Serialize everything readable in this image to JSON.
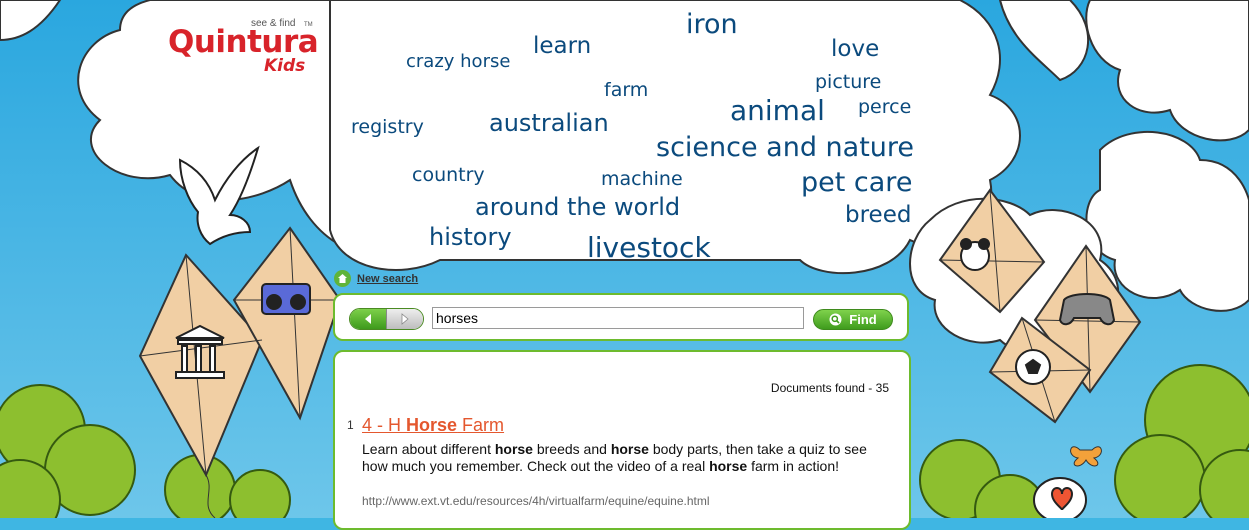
{
  "logo": {
    "brand": "Quintura",
    "tagline": "see & find",
    "trademark": "TM",
    "sub": "Kids"
  },
  "tag_cloud": [
    {
      "id": "iron",
      "text": "iron"
    },
    {
      "id": "learn",
      "text": "learn"
    },
    {
      "id": "love",
      "text": "love"
    },
    {
      "id": "crazy-horse",
      "text": "crazy horse"
    },
    {
      "id": "picture",
      "text": "picture"
    },
    {
      "id": "farm",
      "text": "farm"
    },
    {
      "id": "animal",
      "text": "animal"
    },
    {
      "id": "perce",
      "text": "perce"
    },
    {
      "id": "registry",
      "text": "registry"
    },
    {
      "id": "australian",
      "text": "australian"
    },
    {
      "id": "science-and-nature",
      "text": "science and nature"
    },
    {
      "id": "country",
      "text": "country"
    },
    {
      "id": "machine",
      "text": "machine"
    },
    {
      "id": "pet-care",
      "text": "pet care"
    },
    {
      "id": "around-the-world",
      "text": "around the world"
    },
    {
      "id": "breed",
      "text": "breed"
    },
    {
      "id": "history",
      "text": "history"
    },
    {
      "id": "livestock",
      "text": "livestock"
    }
  ],
  "new_search": {
    "label": "New search",
    "icon": "home-icon"
  },
  "search": {
    "value": "horses",
    "find_label": "Find",
    "back_icon": "arrow-left-icon",
    "forward_icon": "arrow-right-icon",
    "find_icon": "search-icon"
  },
  "results": {
    "count_label": "Documents found - 35",
    "items": [
      {
        "num": "1",
        "title_pre": "4 - H ",
        "title_bold": "Horse",
        "title_post": " Farm",
        "desc_parts": [
          "Learn about different ",
          "horse",
          " breeds and ",
          "horse",
          " body parts, then take a quiz to see how much you remember. Check out the video of a real ",
          "horse",
          " farm in action!"
        ],
        "url": "http://www.ext.vt.edu/resources/4h/virtualfarm/equine/equine.html"
      }
    ]
  },
  "illustrations": [
    "dove",
    "kite",
    "greek-temple-icon",
    "boombox-icon",
    "panda-icon",
    "gamepad-icon",
    "soccer-ball-icon",
    "butterfly",
    "heart-cloud"
  ],
  "colors": {
    "sky": "#3fb6e3",
    "cloud_text": "#0b4a7d",
    "accent_green": "#6dbb2e",
    "title_orange": "#e4572e",
    "logo_red": "#d8232a"
  }
}
